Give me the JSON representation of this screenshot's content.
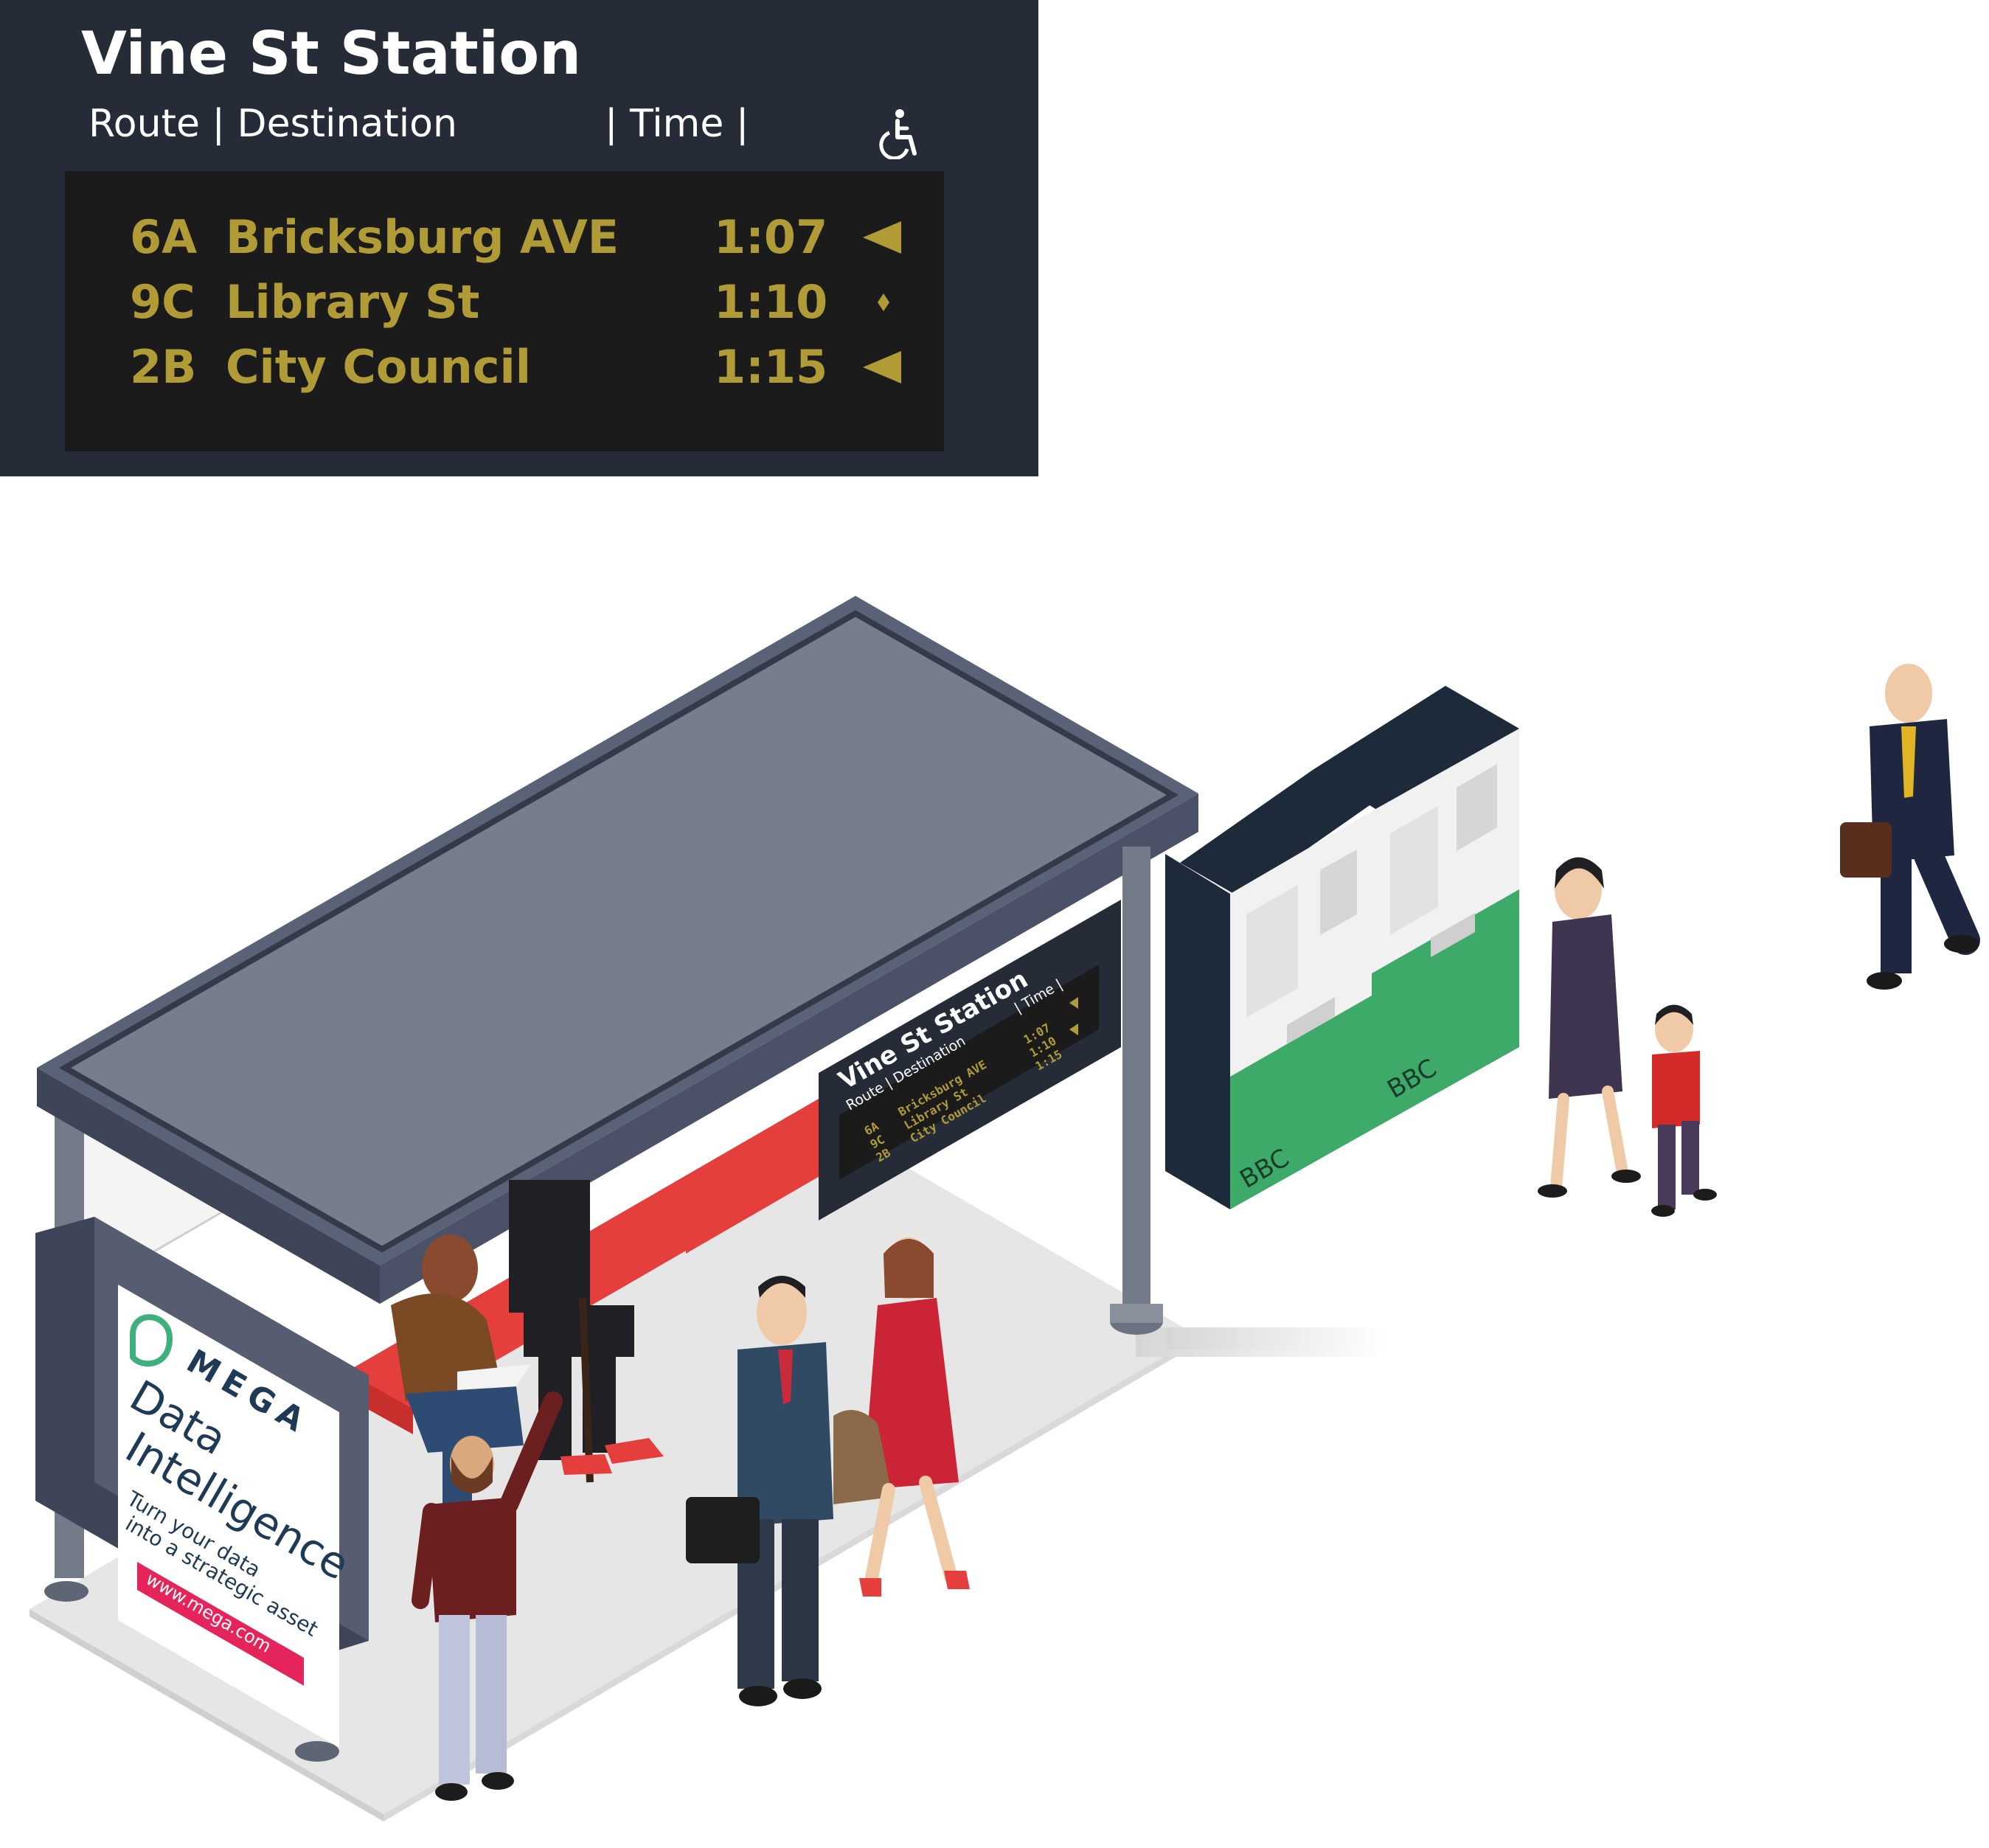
{
  "board": {
    "title": "Vine St Station",
    "route_header": "Route | Destination",
    "time_header": "| Time |",
    "accessibility_icon": "wheelchair-icon",
    "rows": [
      {
        "route": "6A",
        "destination": "Bricksburg AVE",
        "time": "1:07",
        "indicator": "left-arrow-icon"
      },
      {
        "route": "9C",
        "destination": "Library St",
        "time": "1:10",
        "indicator": "diamond-icon"
      },
      {
        "route": "2B",
        "destination": "City Council",
        "time": "1:15",
        "indicator": "left-arrow-icon"
      }
    ]
  },
  "shelter_sign": {
    "title": "Vine St Station",
    "route_header": "Route | Destination",
    "time_header": "| Time |",
    "rows": [
      {
        "route": "6A",
        "destination": "Bricksburg AVE",
        "time": "1:07"
      },
      {
        "route": "9C",
        "destination": "Library St",
        "time": "1:10"
      },
      {
        "route": "2B",
        "destination": "City Council",
        "time": "1:15"
      }
    ]
  },
  "ad": {
    "brand": "MEGA",
    "headline_1": "Data",
    "headline_2": "Intelligence",
    "tagline_1": "Turn your data",
    "tagline_2": "into a strategic asset",
    "url": "www.mega.com"
  },
  "kiosk": {
    "logo": "BBC"
  },
  "colors": {
    "board_bg": "#262b38",
    "led_bg": "#1b1b1b",
    "led_text": "#b19b36",
    "shelter_roof": "#767d8d",
    "bench_red": "#e53f3d",
    "kiosk_green": "#3daa6a",
    "ad_pink": "#e4245b"
  }
}
